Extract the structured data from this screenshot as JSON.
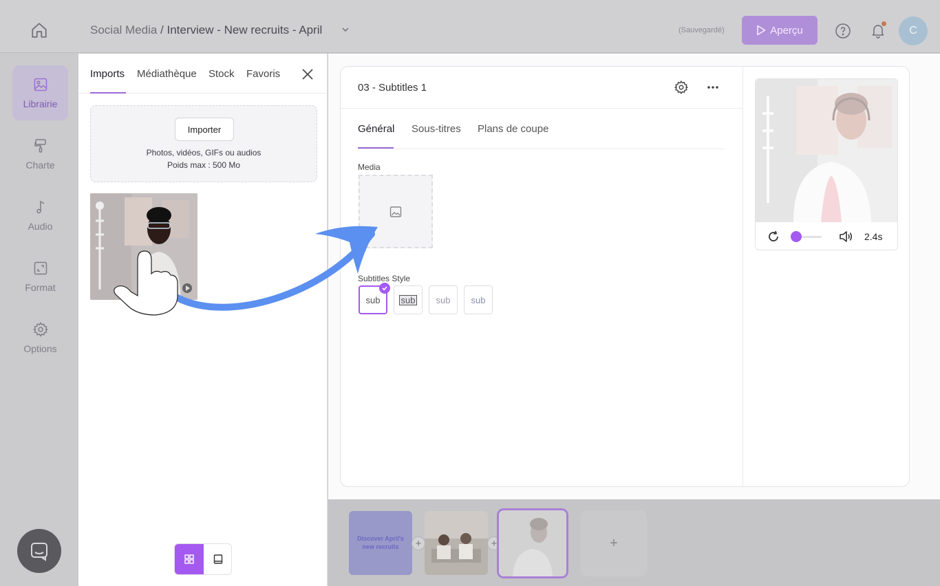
{
  "topbar": {
    "breadcrumb_root": "Social Media",
    "breadcrumb_sep": " / ",
    "breadcrumb_project": "Interview - New recruits - April",
    "saved_status": "(Sauvegardé)",
    "preview_label": "Aperçu",
    "avatar_initial": "C"
  },
  "sidebar": {
    "items": [
      {
        "label": "Librairie",
        "icon": "image-icon",
        "active": true
      },
      {
        "label": "Charte",
        "icon": "paint-roller-icon",
        "active": false
      },
      {
        "label": "Audio",
        "icon": "music-note-icon",
        "active": false
      },
      {
        "label": "Format",
        "icon": "resize-icon",
        "active": false
      },
      {
        "label": "Options",
        "icon": "gear-icon",
        "active": false
      }
    ]
  },
  "library": {
    "tabs": [
      "Imports",
      "Médiathèque",
      "Stock",
      "Favoris"
    ],
    "active_tab": "Imports",
    "import_button": "Importer",
    "dropzone_line1": "Photos, vidéos, GIFs ou audios",
    "dropzone_line2": "Poids max : 500 Mo"
  },
  "editor": {
    "scene_title": "03 - Subtitles 1",
    "tabs": [
      "Général",
      "Sous-titres",
      "Plans de coupe"
    ],
    "active_tab": "Général",
    "media_label": "Media",
    "subtitles_style_label": "Subtitles Style",
    "subtitle_styles": [
      "sub",
      "sub",
      "sub",
      "sub"
    ]
  },
  "player": {
    "duration": "2.4s"
  },
  "timeline": {
    "scene1_text": "Discover April's new recruits",
    "add_symbol": "+"
  },
  "colors": {
    "accent": "#a45af0",
    "arrow": "#5b8ff0",
    "overlay": "#c9c9cb"
  }
}
